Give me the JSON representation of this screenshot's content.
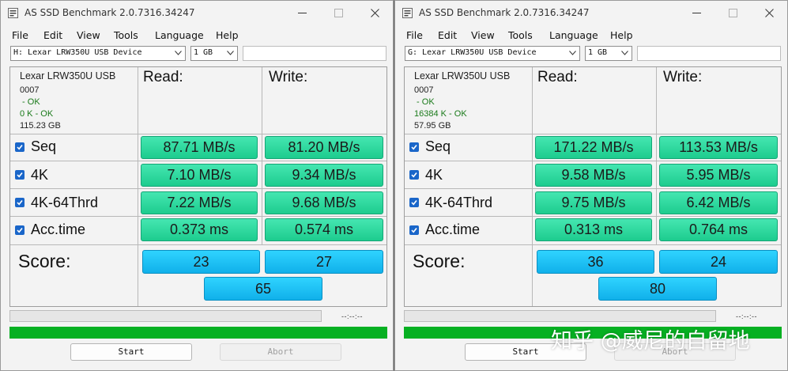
{
  "window_title": "AS SSD Benchmark 2.0.7316.34247",
  "menu": [
    "File",
    "Edit",
    "View",
    "Tools",
    "Language",
    "Help"
  ],
  "columns": {
    "read": "Read:",
    "write": "Write:"
  },
  "rows": [
    "Seq",
    "4K",
    "4K-64Thrd",
    "Acc.time"
  ],
  "score_label": "Score:",
  "timer": "--:--:--",
  "buttons": {
    "start": "Start",
    "abort": "Abort"
  },
  "watermark": "知乎 @威尼的自留地",
  "colors": {
    "result_green": "#2bd79c",
    "score_blue": "#1cc0f5",
    "progress_green": "#06b022",
    "check_blue": "#1a66c9"
  },
  "icons": [
    "app-icon",
    "minimize-icon",
    "maximize-icon",
    "close-icon",
    "chevron-down-icon",
    "checkbox-checked-icon"
  ],
  "left": {
    "drive": "H: Lexar LRW350U USB Device",
    "size": "1 GB",
    "device_name": "Lexar LRW350U USB",
    "firmware": "0007",
    "driver_status": " - OK",
    "align_status": "0 K - OK",
    "capacity": "115.23 GB",
    "read": [
      "87.71 MB/s",
      "7.10 MB/s",
      "7.22 MB/s",
      "0.373 ms"
    ],
    "write": [
      "81.20 MB/s",
      "9.34 MB/s",
      "9.68 MB/s",
      "0.574 ms"
    ],
    "score_read": "23",
    "score_write": "27",
    "score_total": "65"
  },
  "right": {
    "drive": "G: Lexar LRW350U USB Device",
    "size": "1 GB",
    "device_name": "Lexar LRW350U USB",
    "firmware": "0007",
    "driver_status": " - OK",
    "align_status": "16384 K - OK",
    "capacity": "57.95 GB",
    "read": [
      "171.22 MB/s",
      "9.58 MB/s",
      "9.75 MB/s",
      "0.313 ms"
    ],
    "write": [
      "113.53 MB/s",
      "5.95 MB/s",
      "6.42 MB/s",
      "0.764 ms"
    ],
    "score_read": "36",
    "score_write": "24",
    "score_total": "80"
  }
}
